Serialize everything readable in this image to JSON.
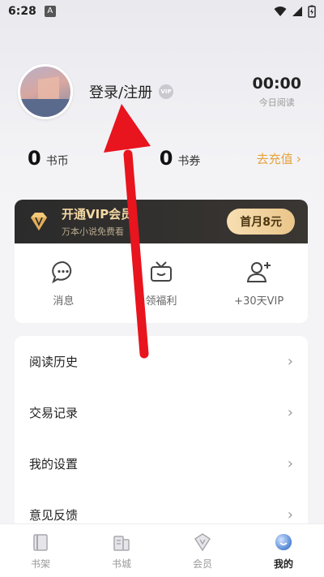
{
  "status_bar": {
    "time": "6:28",
    "notification_icon": "A"
  },
  "profile": {
    "login_label": "登录/注册",
    "vip_badge": "VIP"
  },
  "reading": {
    "time": "00:00",
    "label": "今日阅读"
  },
  "stats": {
    "coins_value": "0",
    "coins_label": "书币",
    "coupons_value": "0",
    "coupons_label": "书券",
    "recharge_label": "去充值"
  },
  "vip_banner": {
    "title": "开通VIP会员",
    "subtitle": "万本小说免费看",
    "button": "首月8元"
  },
  "quick_actions": [
    {
      "label": "消息",
      "icon": "message-icon"
    },
    {
      "label": "领福利",
      "icon": "tv-gift-icon"
    },
    {
      "label": "+30天VIP",
      "icon": "add-user-icon"
    }
  ],
  "menu": [
    {
      "label": "阅读历史"
    },
    {
      "label": "交易记录"
    },
    {
      "label": "我的设置"
    },
    {
      "label": "意见反馈"
    }
  ],
  "tabs": [
    {
      "label": "书架",
      "icon": "bookshelf-icon",
      "active": false
    },
    {
      "label": "书城",
      "icon": "bookstore-icon",
      "active": false
    },
    {
      "label": "会员",
      "icon": "member-icon",
      "active": false
    },
    {
      "label": "我的",
      "icon": "profile-icon",
      "active": true
    }
  ],
  "colors": {
    "accent": "#e8a23a",
    "vip_gold": "#f5d9a4",
    "annotation_arrow": "#e8141e"
  }
}
